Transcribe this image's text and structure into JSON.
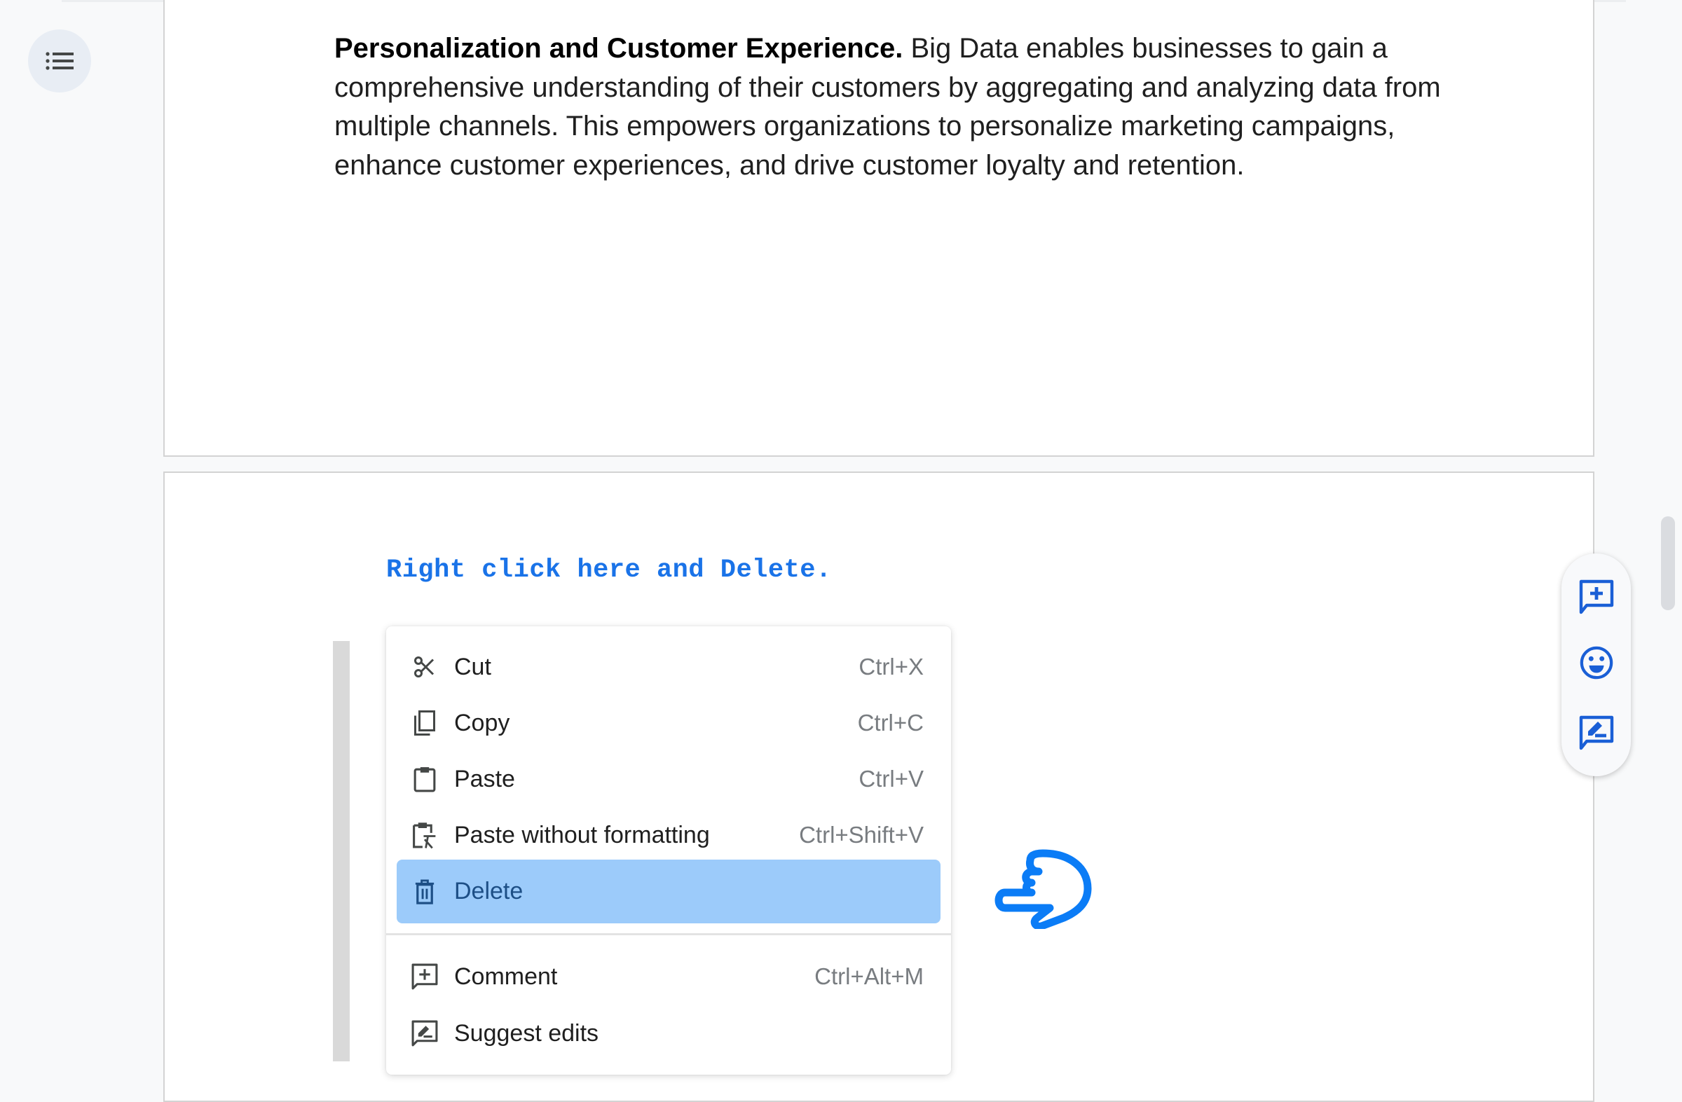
{
  "outline_button": {
    "icon": "list-icon",
    "label": "Document outline"
  },
  "page1": {
    "paragraph_bold": "Personalization and Customer Experience.",
    "paragraph_text": " Big Data enables businesses to gain a comprehensive understanding of their customers by aggregating and analyzing data from multiple channels. This empowers organizations to personalize marketing campaigns, enhance customer experiences, and drive customer loyalty and retention."
  },
  "page2": {
    "instruction": "Right click here and Delete."
  },
  "context_menu": {
    "items": [
      {
        "label": "Cut",
        "shortcut": "Ctrl+X",
        "icon": "scissors-icon"
      },
      {
        "label": "Copy",
        "shortcut": "Ctrl+C",
        "icon": "copy-icon"
      },
      {
        "label": "Paste",
        "shortcut": "Ctrl+V",
        "icon": "clipboard-icon"
      },
      {
        "label": "Paste without formatting",
        "shortcut": "Ctrl+Shift+V",
        "icon": "clipboard-clear-format-icon"
      },
      {
        "label": "Delete",
        "shortcut": "",
        "icon": "trash-icon",
        "highlighted": true
      },
      {
        "label": "Comment",
        "shortcut": "Ctrl+Alt+M",
        "icon": "add-comment-icon"
      },
      {
        "label": "Suggest edits",
        "shortcut": "",
        "icon": "suggest-edits-icon"
      }
    ]
  },
  "side_actions": [
    {
      "label": "Add comment",
      "icon": "add-comment-icon"
    },
    {
      "label": "Add emoji reaction",
      "icon": "emoji-icon"
    },
    {
      "label": "Suggest edits",
      "icon": "suggest-edits-icon"
    }
  ],
  "colors": {
    "accent": "#1a73e8",
    "highlight": "#9ccbfa",
    "cursor": "#0b7cf6"
  }
}
